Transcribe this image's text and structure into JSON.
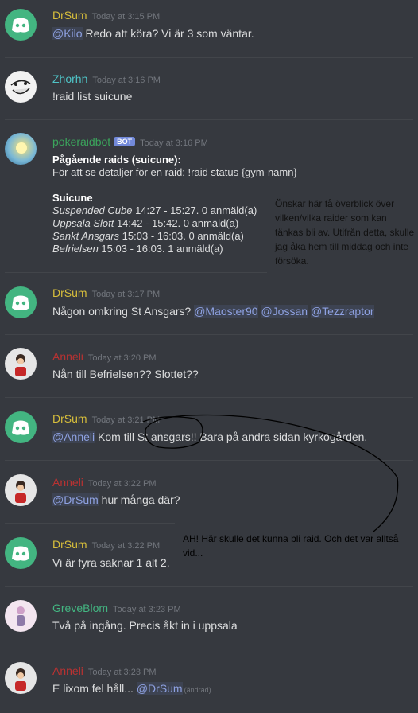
{
  "colors": {
    "background": "#36393f",
    "drsum": "#d7be3b",
    "zhorhn": "#4fc3c6",
    "pokeraidbot": "#3ba55c",
    "anneli": "#b93232",
    "greveblom": "#43b581",
    "mention": "#8ea1e1"
  },
  "messages": [
    {
      "author": "DrSum",
      "timestamp": "Today at 3:15 PM",
      "mention": "@Kilo",
      "text": " Redo att köra? Vi är 3 som väntar."
    },
    {
      "author": "Zhorhn",
      "timestamp": "Today at 3:16 PM",
      "text": "!raid list suicune"
    },
    {
      "author": "pokeraidbot",
      "badge": "BOT",
      "timestamp": "Today at 3:16 PM",
      "embed": {
        "title": "Pågående raids (suicune):",
        "subtitle": "För att se detaljer för en raid: !raid status {gym-namn}",
        "pokemon": "Suicune",
        "raids": [
          {
            "gym": "Suspended Cube",
            "info": " 14:27 - 15:27. 0 anmäld(a)"
          },
          {
            "gym": "Uppsala Slott",
            "info": " 14:42 - 15:42. 0 anmäld(a)"
          },
          {
            "gym": "Sankt Ansgars",
            "info": " 15:03 - 16:03. 0 anmäld(a)"
          },
          {
            "gym": "Befrielsen",
            "info": " 15:03 - 16:03. 1 anmäld(a)"
          }
        ]
      }
    },
    {
      "author": "DrSum",
      "timestamp": "Today at 3:17 PM",
      "text": "Någon omkring St Ansgars? ",
      "mentions": [
        "@Maoster90",
        "@Jossan",
        "@Tezzraptor"
      ]
    },
    {
      "author": "Anneli",
      "timestamp": "Today at 3:20 PM",
      "text": "Nån till Befrielsen?? Slottet??"
    },
    {
      "author": "DrSum",
      "timestamp": "Today at 3:21 PM",
      "mention": "@Anneli",
      "text": " Kom till St ansgars!! Bara på andra sidan kyrkogården."
    },
    {
      "author": "Anneli",
      "timestamp": "Today at 3:22 PM",
      "mention": "@DrSum",
      "text": " hur många där?"
    },
    {
      "author": "DrSum",
      "timestamp": "Today at 3:22 PM",
      "text": "Vi är fyra saknar 1 alt 2."
    },
    {
      "author": "GreveBlom",
      "timestamp": "Today at 3:23 PM",
      "text": "Två på ingång. Precis åkt in i uppsala"
    },
    {
      "author": "Anneli",
      "timestamp": "Today at 3:23 PM",
      "text": "E lixom fel håll... ",
      "mention": "@DrSum",
      "edited": "(ändrad)"
    }
  ],
  "annotations": {
    "note1": "Önskar här få överblick över vilken/vilka raider som kan tänkas bli av. Utifrån detta, skulle jag åka hem till middag och inte försöka.",
    "note2": "AH! Här skulle det kunna bli raid. Och det var alltså vid..."
  }
}
